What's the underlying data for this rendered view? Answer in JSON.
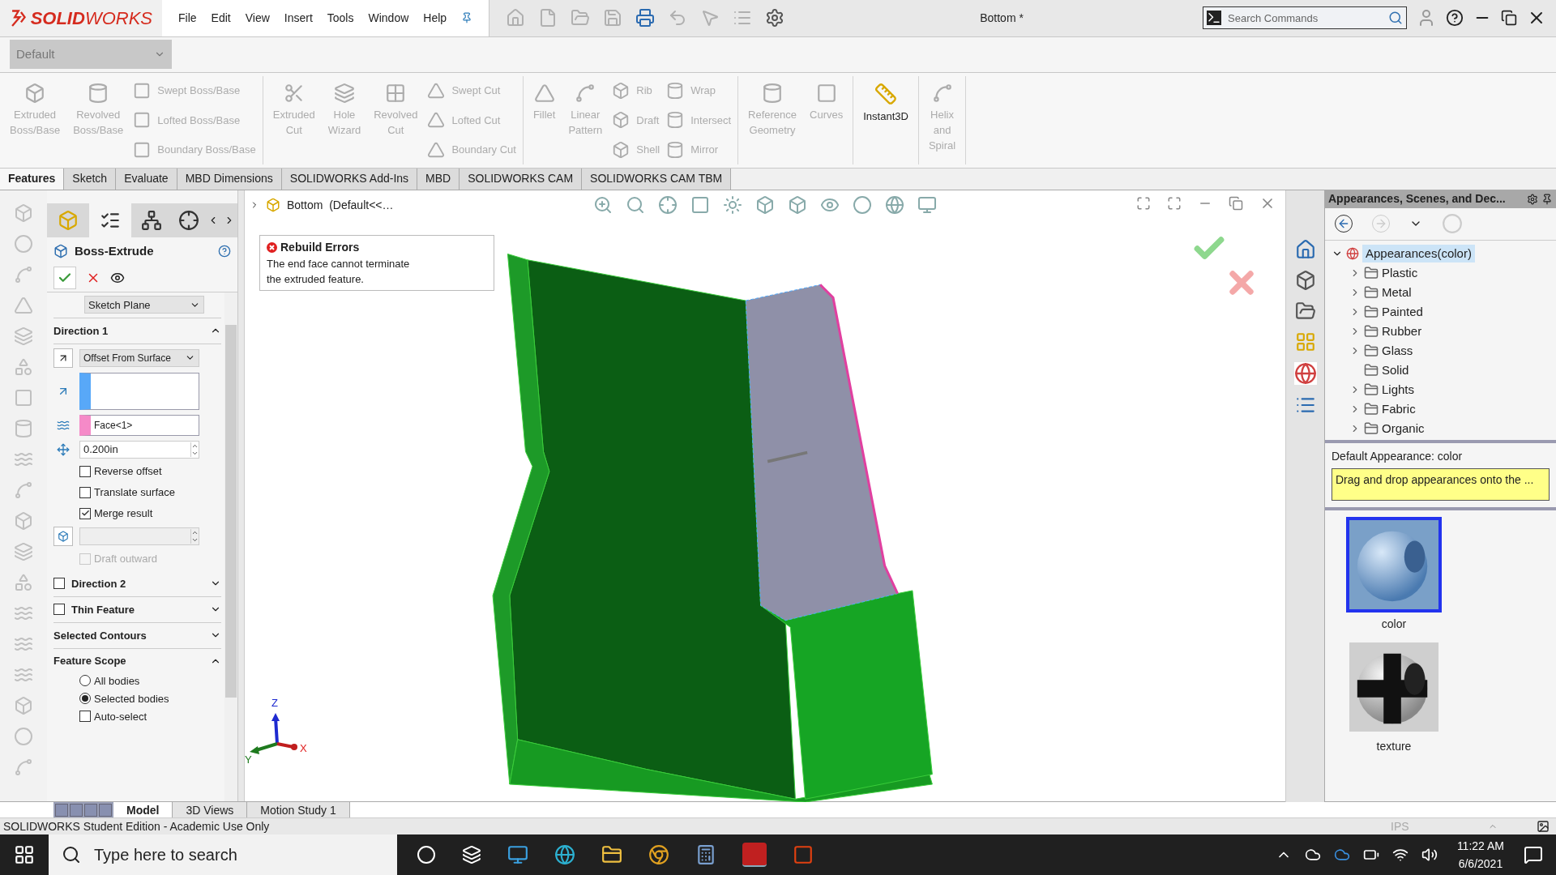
{
  "app": {
    "logo": "**SOLID**WORKS",
    "menu": [
      "File",
      "Edit",
      "View",
      "Insert",
      "Tools",
      "Window",
      "Help"
    ],
    "title": "Bottom *",
    "search": {
      "placeholder": "Search Commands"
    }
  },
  "configuration": {
    "value": "Default"
  },
  "ribbon": [
    {
      "items": [
        {
          "kind": "large",
          "label": "Extruded\nBoss/Base",
          "disabled": true
        },
        {
          "kind": "large",
          "label": "Revolved\nBoss/Base",
          "disabled": true
        },
        {
          "kind": "stack",
          "items": [
            {
              "label": "Swept Boss/Base",
              "disabled": true
            },
            {
              "label": "Lofted Boss/Base",
              "disabled": true
            },
            {
              "label": "Boundary Boss/Base",
              "disabled": true
            }
          ]
        }
      ]
    },
    {
      "items": [
        {
          "kind": "large",
          "label": "Extruded\nCut",
          "disabled": true
        },
        {
          "kind": "large",
          "label": "Hole\nWizard",
          "disabled": true
        },
        {
          "kind": "large",
          "label": "Revolved\nCut",
          "disabled": true
        },
        {
          "kind": "stack",
          "items": [
            {
              "label": "Swept Cut",
              "disabled": true
            },
            {
              "label": "Lofted Cut",
              "disabled": true
            },
            {
              "label": "Boundary Cut",
              "disabled": true
            }
          ]
        }
      ]
    },
    {
      "items": [
        {
          "kind": "large",
          "label": "Fillet",
          "disabled": true
        },
        {
          "kind": "large",
          "label": "Linear\nPattern",
          "disabled": true
        },
        {
          "kind": "stack",
          "items": [
            {
              "label": "Rib",
              "disabled": true
            },
            {
              "label": "Draft",
              "disabled": true
            },
            {
              "label": "Shell",
              "disabled": true
            }
          ]
        },
        {
          "kind": "stack",
          "items": [
            {
              "label": "Wrap",
              "disabled": true
            },
            {
              "label": "Intersect",
              "disabled": true
            },
            {
              "label": "Mirror",
              "disabled": true
            }
          ]
        }
      ]
    },
    {
      "items": [
        {
          "kind": "large",
          "label": "Reference\nGeometry",
          "disabled": true
        },
        {
          "kind": "large",
          "label": "Curves",
          "disabled": true
        }
      ]
    },
    {
      "items": [
        {
          "kind": "large",
          "label": "Instant3D",
          "disabled": false
        }
      ]
    },
    {
      "items": [
        {
          "kind": "large",
          "label": "Helix\nand\nSpiral",
          "disabled": true
        }
      ]
    }
  ],
  "tabs": [
    {
      "label": "Features",
      "selected": true
    },
    {
      "label": "Sketch",
      "selected": false
    },
    {
      "label": "Evaluate",
      "selected": false
    },
    {
      "label": "MBD Dimensions",
      "selected": false
    },
    {
      "label": "SOLIDWORKS Add-Ins",
      "selected": false
    },
    {
      "label": "MBD",
      "selected": false
    },
    {
      "label": "SOLIDWORKS CAM",
      "selected": false
    },
    {
      "label": "SOLIDWORKS CAM TBM",
      "selected": false
    }
  ],
  "property_manager": {
    "title": "Boss-Extrude",
    "from": {
      "value": "Sketch Plane"
    },
    "sections": [
      {
        "kind": "direction",
        "title": "Direction 1",
        "expanded": true,
        "end_condition": "Offset From Surface",
        "face": "Face<1>",
        "offset": "0.200in",
        "options": [
          {
            "label": "Reverse offset",
            "checked": false,
            "disabled": false
          },
          {
            "label": "Translate surface",
            "checked": false,
            "disabled": false
          },
          {
            "label": "Merge result",
            "checked": true,
            "disabled": false
          }
        ],
        "draft_outward": {
          "label": "Draft outward",
          "checked": false,
          "disabled": true
        }
      },
      {
        "kind": "toggle",
        "title": "Direction 2",
        "checked": false,
        "expanded": false
      },
      {
        "kind": "toggle",
        "title": "Thin Feature",
        "checked": false,
        "expanded": false
      },
      {
        "kind": "plain",
        "title": "Selected Contours",
        "expanded": false
      },
      {
        "kind": "scope",
        "title": "Feature Scope",
        "expanded": true,
        "radios": [
          {
            "label": "All bodies",
            "selected": false
          },
          {
            "label": "Selected bodies",
            "selected": true
          }
        ],
        "auto_select": {
          "label": "Auto-select",
          "checked": false
        }
      }
    ]
  },
  "graphics": {
    "breadcrumb": "Bottom  (Default<<…",
    "error": {
      "title": "Rebuild Errors",
      "message": "The end face cannot terminate\n the extruded feature."
    },
    "axes": [
      "Z",
      "Y",
      "X"
    ]
  },
  "task_pane": {
    "title": "Appearances, Scenes, and Dec...",
    "tree": [
      {
        "label": "Appearances(color)",
        "selected": true,
        "expanded": true,
        "children": [
          {
            "label": "Plastic",
            "expandable": true
          },
          {
            "label": "Metal",
            "expandable": true
          },
          {
            "label": "Painted",
            "expandable": true
          },
          {
            "label": "Rubber",
            "expandable": true
          },
          {
            "label": "Glass",
            "expandable": true
          },
          {
            "label": "Solid",
            "expandable": false
          },
          {
            "label": "Lights",
            "expandable": true
          },
          {
            "label": "Fabric",
            "expandable": true
          },
          {
            "label": "Organic",
            "expandable": true
          }
        ]
      }
    ],
    "default_appearance": "Default Appearance: color",
    "hint": "Drag and drop appearances onto the ...",
    "swatches": [
      {
        "label": "color",
        "kind": "glossy",
        "selected": true
      },
      {
        "label": "texture",
        "kind": "checker",
        "selected": false
      }
    ]
  },
  "bottom_tabs": [
    {
      "label": "Model",
      "selected": true
    },
    {
      "label": "3D Views",
      "selected": false
    },
    {
      "label": "Motion Study 1",
      "selected": false
    }
  ],
  "status_bar": {
    "message": "SOLIDWORKS Student Edition - Academic Use Only",
    "units": "IPS"
  },
  "taskbar": {
    "search_placeholder": "Type here to search",
    "time": "11:22 AM",
    "date": "6/6/2021"
  }
}
